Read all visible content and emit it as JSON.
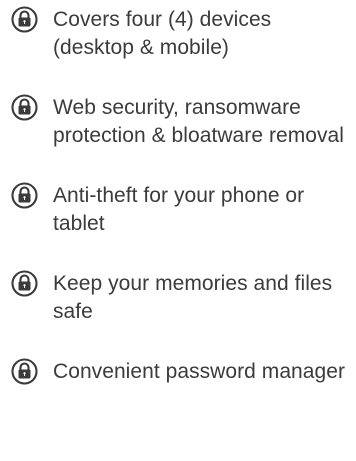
{
  "icons": {
    "item_icon": "lock-icon",
    "icon_color": "#3b3b3b"
  },
  "features": [
    {
      "text": "Covers four (4) devices (desktop & mobile)"
    },
    {
      "text": "Web security, ransomware protection & bloatware removal"
    },
    {
      "text": "Anti-theft for your phone or tablet"
    },
    {
      "text": "Keep your memories and files safe"
    },
    {
      "text": "Convenient password manager"
    }
  ]
}
